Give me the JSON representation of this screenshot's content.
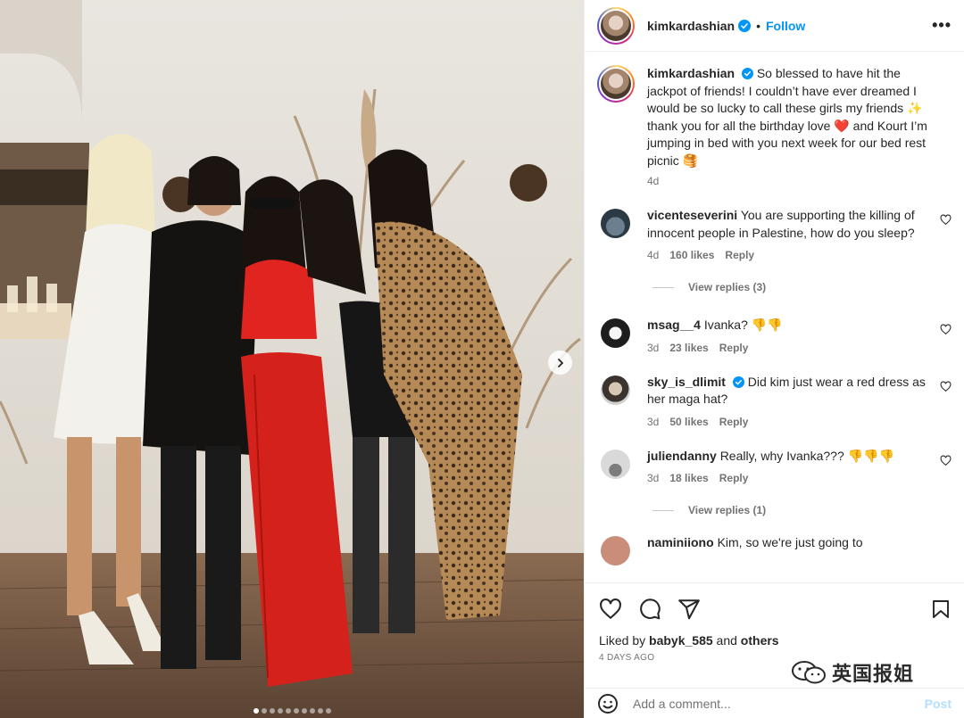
{
  "post": {
    "username": "kimkardashian",
    "follow_label": "Follow",
    "bullet": "•",
    "more_label": "•••",
    "caption_text": "So blessed to have hit the jackpot of friends! I couldn’t have ever dreamed I would be so lucky to call these girls my friends ✨ thank you for all the birthday love ❤️ and Kourt I’m jumping in bed with you next week for our bed rest picnic 🥞",
    "caption_time": "4d",
    "photo_dots": 10,
    "active_dot": 0
  },
  "comments": [
    {
      "username": "vicenteseverini",
      "verified": false,
      "text": "You are supporting the killing of innocent people in Palestine, how do you sleep?",
      "time": "4d",
      "likes": "160 likes",
      "reply_label": "Reply",
      "view_replies": "View replies (3)"
    },
    {
      "username": "msag__4",
      "verified": false,
      "text": "Ivanka? 👎👎",
      "time": "3d",
      "likes": "23 likes",
      "reply_label": "Reply",
      "view_replies": ""
    },
    {
      "username": "sky_is_dlimit",
      "verified": true,
      "text": "Did kim just wear a red dress as her maga hat?",
      "time": "3d",
      "likes": "50 likes",
      "reply_label": "Reply",
      "view_replies": ""
    },
    {
      "username": "juliendanny",
      "verified": false,
      "text": "Really, why Ivanka??? 👎👎👎",
      "time": "3d",
      "likes": "18 likes",
      "reply_label": "Reply",
      "view_replies": "View replies (1)"
    }
  ],
  "partial_comment": {
    "username": "naminiiono",
    "text": "Kim, so we're just going to"
  },
  "footer": {
    "liked_by_prefix": "Liked by",
    "liked_by_user": "babyk_585",
    "liked_by_and": "and",
    "liked_by_others": "others",
    "date": "4 DAYS AGO",
    "add_comment_placeholder": "Add a comment...",
    "post_label": "Post"
  },
  "watermark": {
    "text": "英国报姐"
  },
  "colors": {
    "accent": "#0095f6",
    "muted": "#737373",
    "border": "#efefef",
    "verified": "#0095f6"
  },
  "icons": [
    "verified-badge-icon",
    "more-options-icon",
    "heart-icon",
    "comment-icon",
    "share-icon",
    "bookmark-icon",
    "emoji-icon",
    "chevron-right-icon",
    "wechat-icon"
  ]
}
